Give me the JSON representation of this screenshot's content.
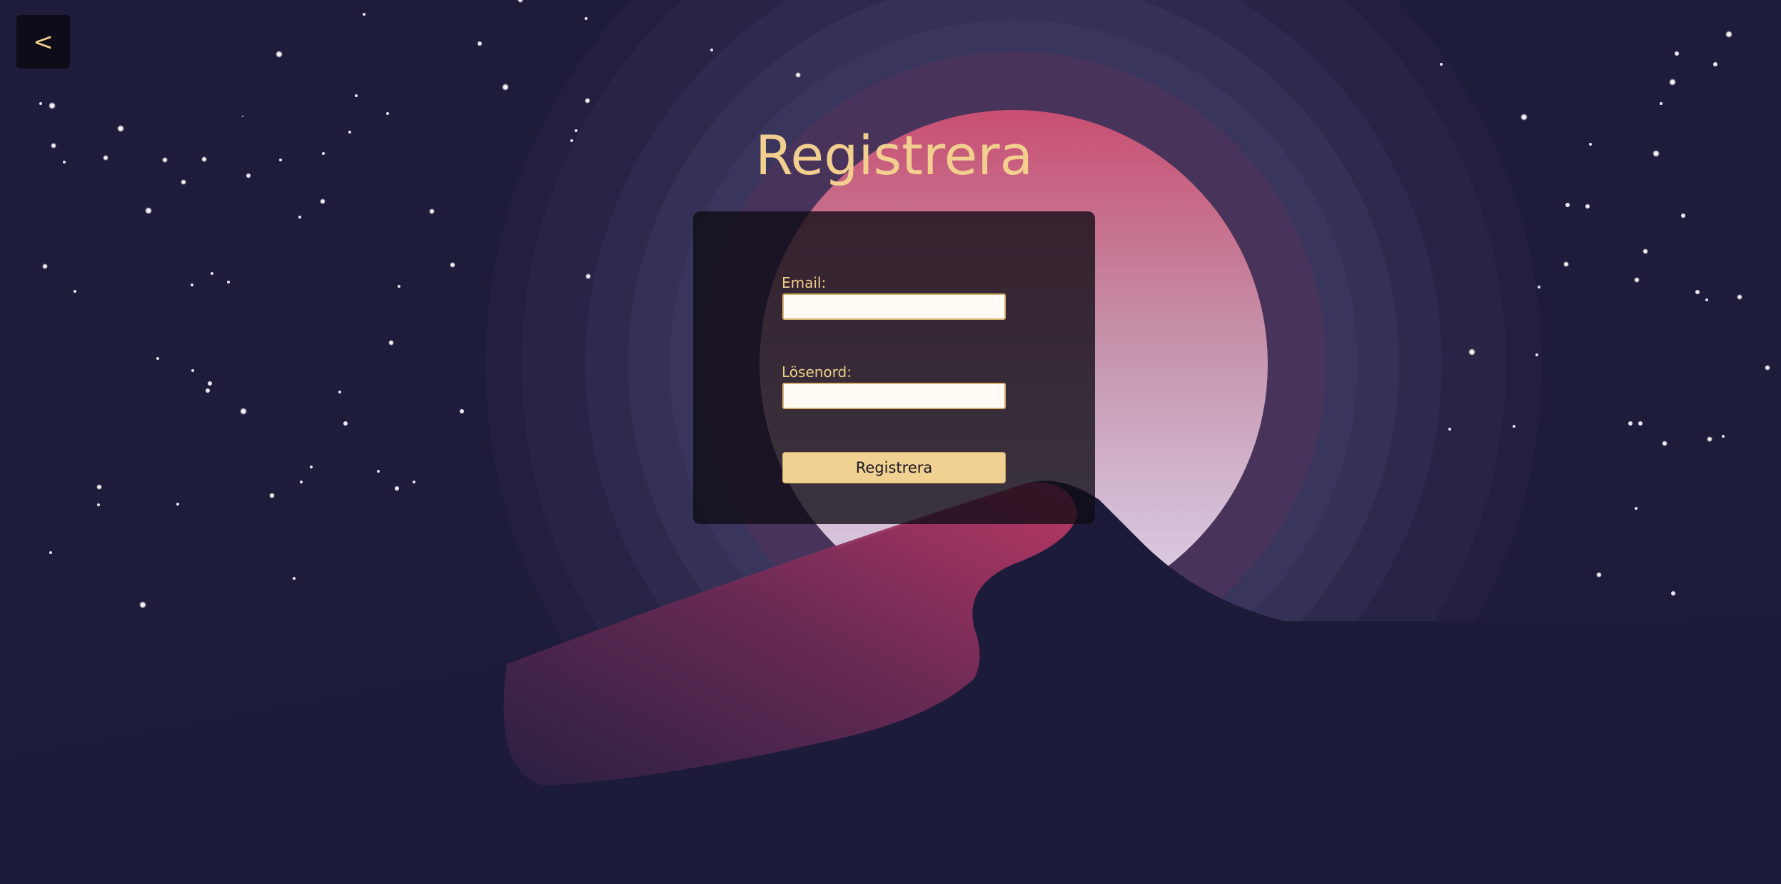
{
  "back_button": {
    "label": "<"
  },
  "page": {
    "title": "Registrera"
  },
  "form": {
    "email": {
      "label": "Email:",
      "value": "",
      "placeholder": ""
    },
    "password": {
      "label": "Lösenord:",
      "value": "",
      "placeholder": ""
    },
    "submit_label": "Registrera"
  },
  "colors": {
    "background": "#1e1c3b",
    "accent": "#f2cf8e",
    "moon_top": "#cc5878",
    "moon_bottom": "#d8d4ec",
    "river": "#b53c66"
  }
}
